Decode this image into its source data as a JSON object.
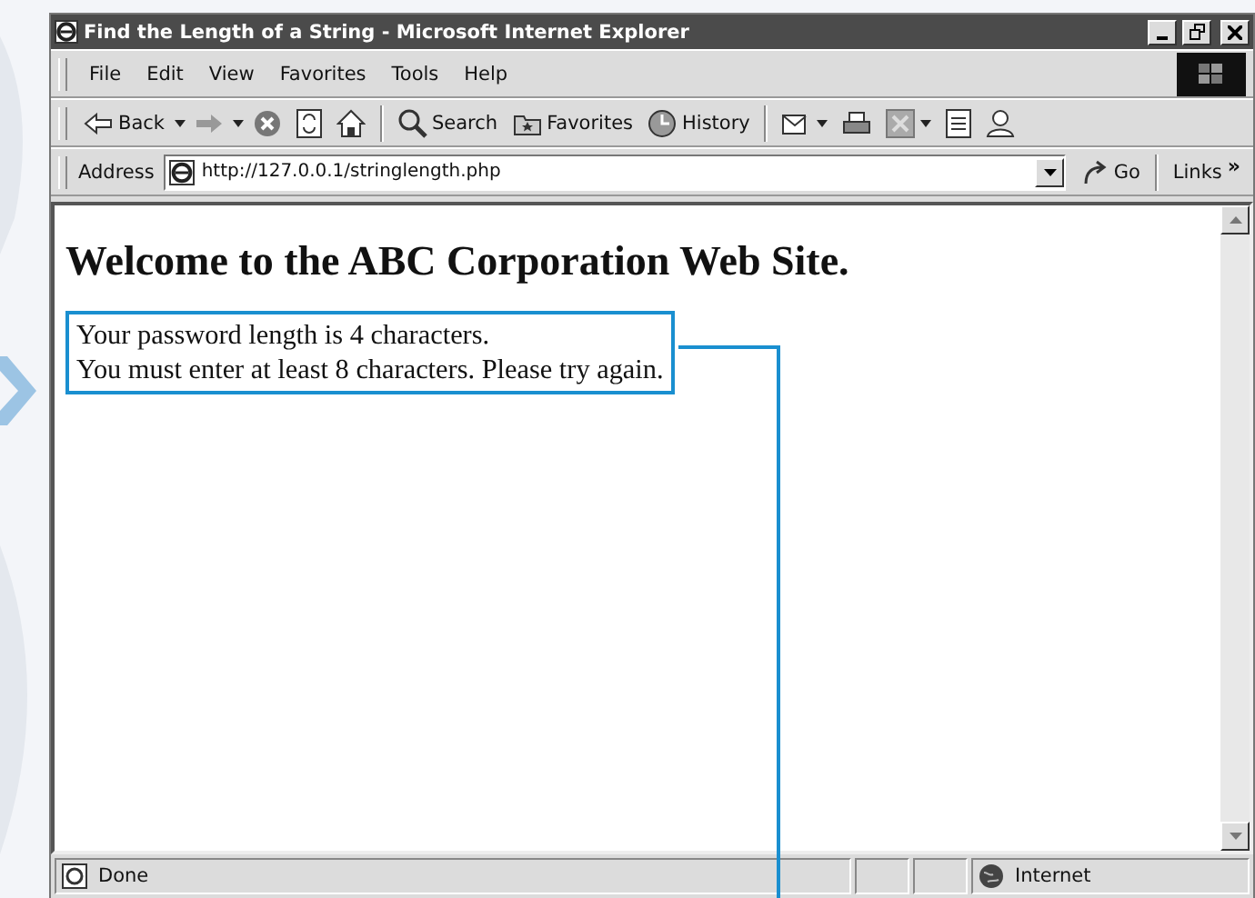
{
  "window": {
    "title": "Find the Length of a String - Microsoft Internet Explorer"
  },
  "menu": [
    "File",
    "Edit",
    "View",
    "Favorites",
    "Tools",
    "Help"
  ],
  "toolbar": {
    "back": "Back",
    "search": "Search",
    "favorites": "Favorites",
    "history": "History"
  },
  "address": {
    "label": "Address",
    "value": "http://127.0.0.1/stringlength.php",
    "go": "Go",
    "links": "Links",
    "links_more": "»"
  },
  "page": {
    "heading": "Welcome to the ABC Corporation Web Site.",
    "message_lines": [
      "Your password length is 4 characters.",
      "You must enter at least 8 characters. Please try again."
    ]
  },
  "status": {
    "text": "Done",
    "zone": "Internet"
  }
}
